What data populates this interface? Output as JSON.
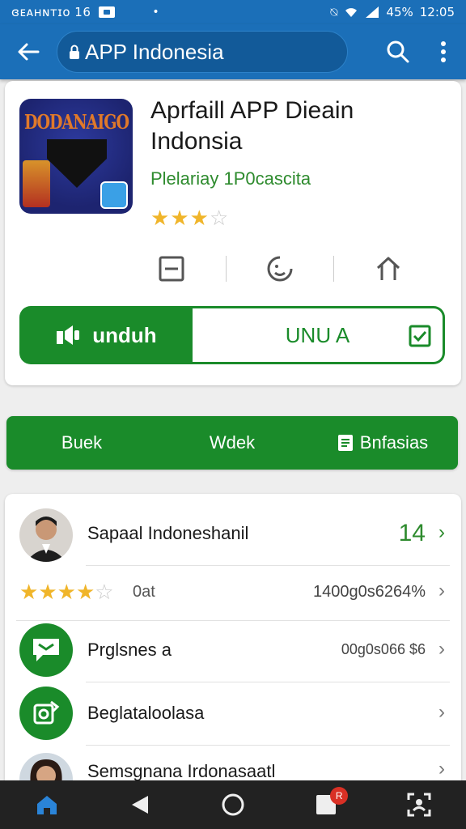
{
  "status_bar": {
    "left_text": "ɞᴇᴀʜɴᴛɪᴏ 16",
    "battery": "45%",
    "time": "12:05"
  },
  "app_bar": {
    "title": "APP Indonesia",
    "back_icon": "arrow-left-icon",
    "search_icon": "search-icon",
    "menu_icon": "more-vert-icon"
  },
  "app": {
    "icon_text": "DODANAIGO",
    "title": "Aprfaill APP Dieain Indonsia",
    "developer": "Plelariay 1P0cascita",
    "rating": {
      "value": 3,
      "max": 5
    },
    "quick_actions": [
      "doc-icon",
      "share-face-icon",
      "home-icon"
    ],
    "primary_button": "unduh",
    "secondary_button": "UNU A"
  },
  "tabs": [
    {
      "label": "Buek"
    },
    {
      "label": "Wdek"
    },
    {
      "label": "Bnfasias",
      "icon": "bookmark-icon"
    }
  ],
  "list": [
    {
      "type": "avatar",
      "label": "Sapaal Indoneshanil",
      "value": "14",
      "value_color": "#2e8b2e"
    },
    {
      "type": "rating",
      "stars": 4,
      "max": 5,
      "label": "0at",
      "value": "1400g0s6264%"
    },
    {
      "type": "icon",
      "icon": "chat-bubble-icon",
      "label": "Prglsnes a",
      "value": "00g0s066 $6"
    },
    {
      "type": "icon",
      "icon": "camera-note-icon",
      "label": "Beglataloolasa",
      "value": ""
    },
    {
      "type": "avatar2",
      "label": "Semsgnana Irdonasaatl",
      "value": ""
    }
  ],
  "nav": {
    "notification_badge": "R",
    "accent": "#1a8b2a",
    "brand": "#1b6fb8"
  }
}
